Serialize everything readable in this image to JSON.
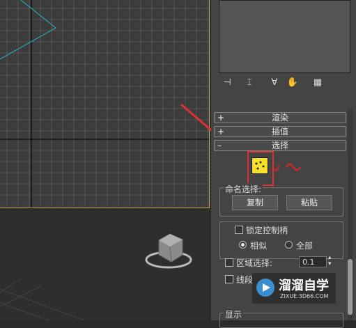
{
  "panel": {
    "rollouts": [
      {
        "sign": "+",
        "label": "渲染"
      },
      {
        "sign": "+",
        "label": "插值"
      },
      {
        "sign": "–",
        "label": "选择"
      }
    ],
    "named_selection": {
      "title": "命名选择:",
      "copy_label": "复制",
      "paste_label": "粘贴"
    },
    "lock_handles_label": "锁定控制柄",
    "similar_label": "相似",
    "all_label": "全部",
    "area_select_label": "区域选择:",
    "area_select_value": "0.1",
    "segment_label": "线段",
    "display_title": "显示"
  },
  "watermark": {
    "brand": "溜溜自学",
    "url": "ZIXUE.3D66.COM"
  },
  "colors": {
    "accent_yellow": "#f5e12a",
    "highlight_red": "#e03030",
    "viewport_border": "#c8a84a"
  }
}
